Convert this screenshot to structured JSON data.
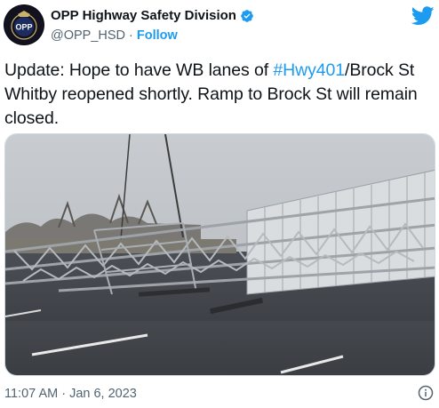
{
  "author": {
    "name": "OPP Highway Safety Division",
    "handle": "@OPP_HSD",
    "separator": "·",
    "follow_label": "Follow",
    "avatar_text": "OPP",
    "verified_icon": "verified-badge-icon"
  },
  "tweet": {
    "text_before": "Update: Hope to have WB lanes of ",
    "hashtag": "#Hwy401",
    "text_after": "/Brock St Whitby reopened shortly. Ramp to Brock St will remain closed."
  },
  "media": {
    "type": "image",
    "description_icon": "photo-collapsed-sign-gantry"
  },
  "footer": {
    "timestamp": "11:07 AM · Jan 6, 2023",
    "info_icon": "info-icon"
  },
  "colors": {
    "accent": "#1d9bf0",
    "text": "#0f1419",
    "muted": "#536471",
    "border": "#cfd9de"
  }
}
